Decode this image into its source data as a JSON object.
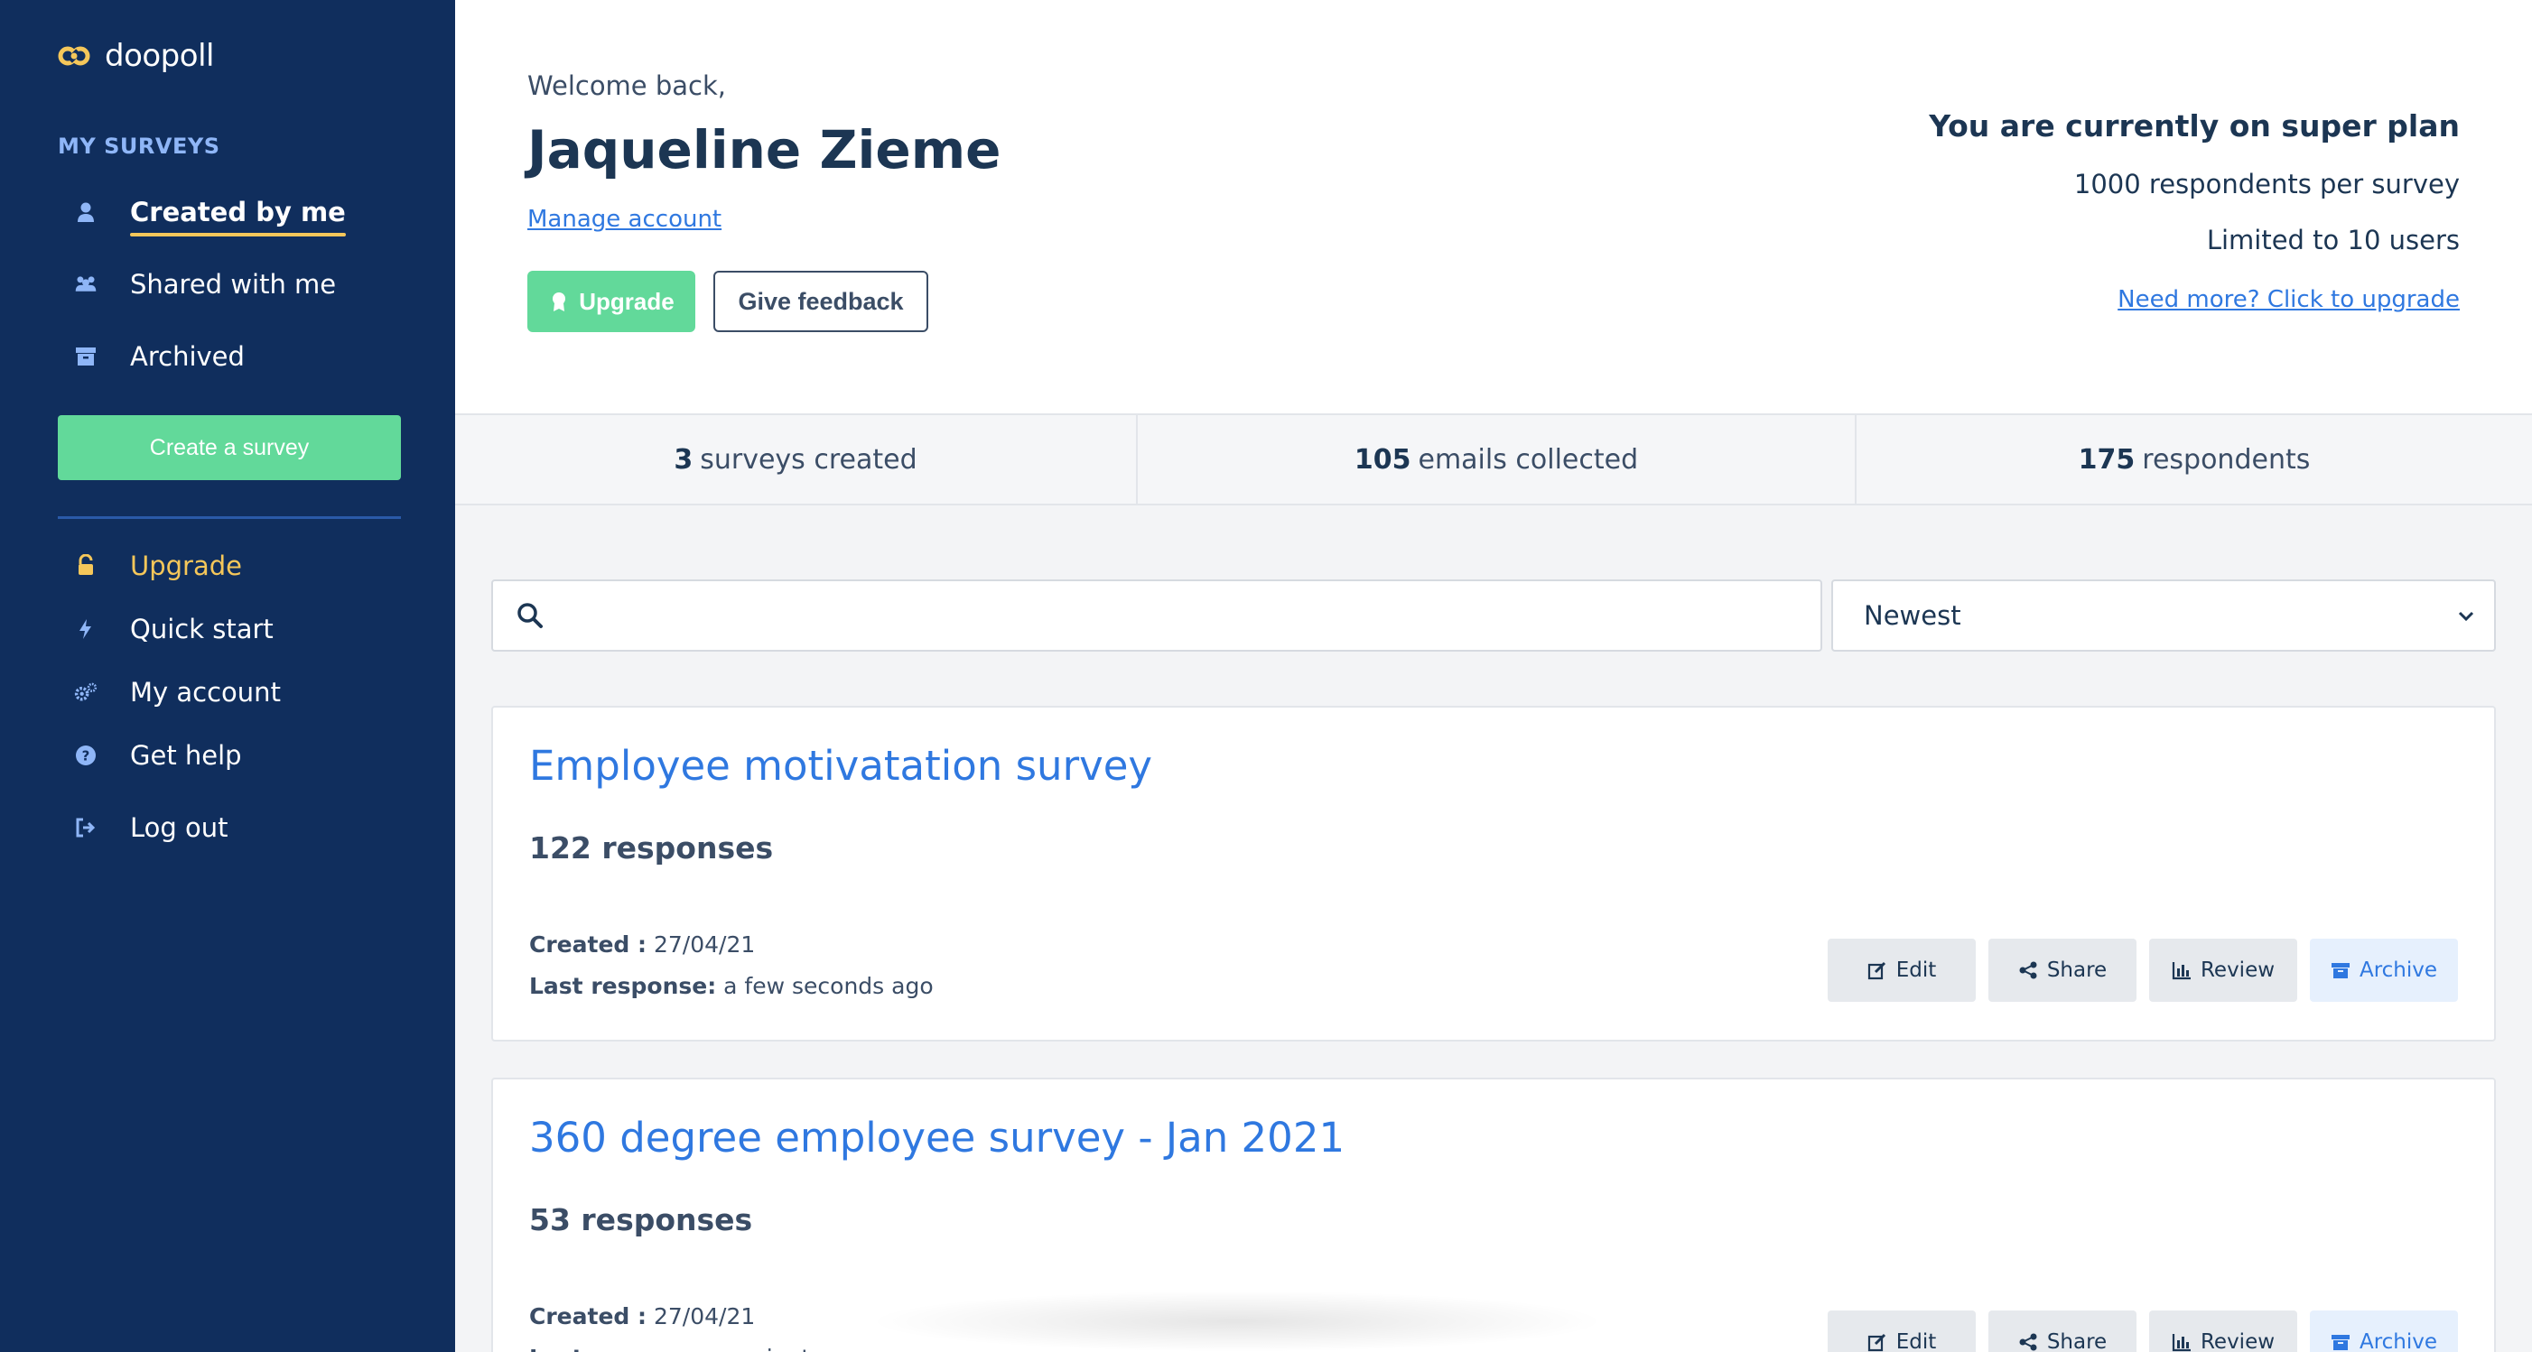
{
  "app": {
    "name": "doopoll"
  },
  "sidebar": {
    "section_title": "MY SURVEYS",
    "items": [
      {
        "label": "Created by me",
        "icon": "user-icon"
      },
      {
        "label": "Shared with me",
        "icon": "users-icon"
      },
      {
        "label": "Archived",
        "icon": "archive-icon"
      }
    ],
    "create_label": "Create a survey",
    "bottom_items": [
      {
        "label": "Upgrade",
        "icon": "lock-icon"
      },
      {
        "label": "Quick start",
        "icon": "bolt-icon"
      },
      {
        "label": "My account",
        "icon": "gears-icon"
      },
      {
        "label": "Get help",
        "icon": "question-icon"
      },
      {
        "label": "Log out",
        "icon": "logout-icon"
      }
    ]
  },
  "header": {
    "welcome": "Welcome back,",
    "user_name": "Jaqueline Zieme",
    "manage_link": "Manage account",
    "upgrade_label": "Upgrade",
    "feedback_label": "Give feedback",
    "plan_title": "You are currently on super plan",
    "plan_respondents": "1000 respondents per survey",
    "plan_users": "Limited to 10 users",
    "plan_link": "Need more? Click to upgrade"
  },
  "stats": [
    {
      "value": "3",
      "label": "surveys created"
    },
    {
      "value": "105",
      "label": "emails collected"
    },
    {
      "value": "175",
      "label": "respondents"
    }
  ],
  "search": {
    "placeholder": "",
    "value": ""
  },
  "sort": {
    "selected": "Newest"
  },
  "actions": {
    "edit": "Edit",
    "share": "Share",
    "review": "Review",
    "archive": "Archive"
  },
  "surveys": [
    {
      "title": "Employee motivatation survey",
      "responses": "122 responses",
      "created_label": "Created :",
      "created": "27/04/21",
      "last_label": "Last response:",
      "last": "a few seconds ago"
    },
    {
      "title": "360 degree employee survey - Jan 2021",
      "responses": "53 responses",
      "created_label": "Created :",
      "created": "27/04/21",
      "last_label": "Last response:",
      "last": "a minute ago"
    }
  ],
  "colors": {
    "sidebar_bg": "#102e5d",
    "accent_green": "#62d99a",
    "accent_yellow": "#f5c75a",
    "link_blue": "#2f78e0"
  }
}
